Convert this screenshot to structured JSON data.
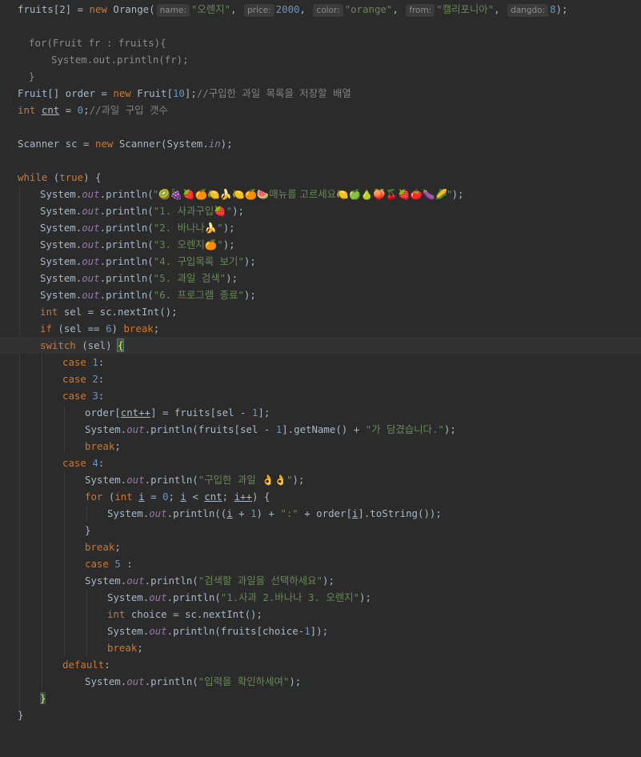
{
  "editor": {
    "l01": {
      "a": "fruits[2] = ",
      "b": "new",
      "c": " Orange(",
      "h1": "name:",
      "s1": "\"오렌지\"",
      "p1": ", ",
      "h2": "price:",
      "n1": "2000",
      "p2": ", ",
      "h3": "color:",
      "s2": "\"orange\"",
      "p3": ", ",
      "h4": "from:",
      "s3": "\"캘리포니아\"",
      "p4": ", ",
      "h5": "dangdo:",
      "n2": "8",
      "e": ");"
    },
    "l02": {
      "a": "for(Fruit fr : fruits){"
    },
    "l03": {
      "a": "System.out.println(fr);"
    },
    "l04": {
      "a": "}"
    },
    "l05": {
      "a": "Fruit[] order = ",
      "b": "new",
      "c": " Fruit[",
      "n": "10",
      "d": "];",
      "cmt": "//구입한 과일 목록을 저장할 배열"
    },
    "l06": {
      "a": "int",
      "b": " ",
      "c": "cnt",
      "d": " = ",
      "n": "0",
      "e": ";",
      "cmt": "//과일 구입 갯수"
    },
    "l07": {
      "a": "Scanner sc = ",
      "b": "new",
      "c": " Scanner(System.",
      "f": "in",
      "d": ");"
    },
    "l08": {
      "a": "while",
      "b": " (",
      "c": "true",
      "d": ") {"
    },
    "l09": {
      "a": "System.",
      "f": "out",
      "b": ".println(",
      "s": "\"🥝🍇🍓🍊🍋🍌🍋🍊🍉매뉴를 고르세요🍋🍏🍐🍑🍒🍓🍅🍆🌽\"",
      "e": ");"
    },
    "l10": {
      "a": "System.",
      "f": "out",
      "b": ".println(",
      "s": "\"1. 사과구입🍓\"",
      "e": ");"
    },
    "l11": {
      "a": "System.",
      "f": "out",
      "b": ".println(",
      "s": "\"2. 바나나🍌\"",
      "e": ");"
    },
    "l12": {
      "a": "System.",
      "f": "out",
      "b": ".println(",
      "s": "\"3. 오렌지🍊\"",
      "e": ");"
    },
    "l13": {
      "a": "System.",
      "f": "out",
      "b": ".println(",
      "s": "\"4. 구입목록 보기\"",
      "e": ");"
    },
    "l14": {
      "a": "System.",
      "f": "out",
      "b": ".println(",
      "s": "\"5. 과일 검색\"",
      "e": ");"
    },
    "l15": {
      "a": "System.",
      "f": "out",
      "b": ".println(",
      "s": "\"6. 프로그램 종료\"",
      "e": ");"
    },
    "l16": {
      "a": "int",
      "b": " sel = sc.nextInt();"
    },
    "l17": {
      "a": "if",
      "b": " (sel == ",
      "n": "6",
      "c": ") ",
      "d": "break",
      "e": ";"
    },
    "l18": {
      "a": "switch",
      "b": " (sel) ",
      "br": "{"
    },
    "l19": {
      "a": "case",
      "b": " ",
      "n": "1",
      "c": ":"
    },
    "l20": {
      "a": "case",
      "b": " ",
      "n": "2",
      "c": ":"
    },
    "l21": {
      "a": "case",
      "b": " ",
      "n": "3",
      "c": ":"
    },
    "l22": {
      "a": "order[",
      "u": "cnt++",
      "b": "] = fruits[sel - ",
      "n": "1",
      "c": "];"
    },
    "l23": {
      "a": "System.",
      "f": "out",
      "b": ".println(fruits[sel - ",
      "n": "1",
      "c": "].getName() + ",
      "s": "\"가 담겼습니다.\"",
      "e": ");"
    },
    "l24": {
      "a": "break",
      "b": ";"
    },
    "l25": {
      "a": "case",
      "b": " ",
      "n": "4",
      "c": ":"
    },
    "l26": {
      "a": "System.",
      "f": "out",
      "b": ".println(",
      "s": "\"구입한 과일 👌👌\"",
      "e": ");"
    },
    "l27": {
      "a": "for",
      "b": " (",
      "c": "int",
      "d": " ",
      "u1": "i",
      "e": " = ",
      "n": "0",
      "g": "; ",
      "u2": "i",
      "h": " < ",
      "u3": "cnt",
      "j": "; ",
      "u4": "i++",
      "k": ") {"
    },
    "l28": {
      "a": "System.",
      "f": "out",
      "b": ".println((",
      "u1": "i",
      "c": " + ",
      "n": "1",
      "d": ") + ",
      "s": "\":\"",
      "e": " + order[",
      "u2": "i",
      "g": "].toString());"
    },
    "l29": {
      "a": "}"
    },
    "l30": {
      "a": "break",
      "b": ";"
    },
    "l31": {
      "a": "case",
      "b": " ",
      "n": "5",
      "c": " :"
    },
    "l32": {
      "a": "System.",
      "f": "out",
      "b": ".println(",
      "s": "\"검색할 과일을 선택하세요\"",
      "e": ");"
    },
    "l33": {
      "a": "System.",
      "f": "out",
      "b": ".println(",
      "s": "\"1.사과 2.바나나 3. 오렌지\"",
      "e": ");"
    },
    "l34": {
      "a": "int",
      "b": " choice = sc.nextInt();"
    },
    "l35": {
      "a": "System.",
      "f": "out",
      "b": ".println(fruits[choice-",
      "n": "1",
      "c": "]);"
    },
    "l36": {
      "a": "break",
      "b": ";"
    },
    "l37": {
      "a": "default",
      "b": ":"
    },
    "l38": {
      "a": "System.",
      "f": "out",
      "b": ".println(",
      "s": "\"입력을 확인하세여\"",
      "e": ");"
    },
    "l39": {
      "a": "}"
    },
    "l40": {
      "a": "}"
    }
  },
  "colors": {
    "background": "#2b2b2b",
    "keyword": "#cc7832",
    "number": "#6897bb",
    "string": "#6a8759",
    "comment": "#808080",
    "field": "#9876aa",
    "text": "#a9b7c6"
  }
}
